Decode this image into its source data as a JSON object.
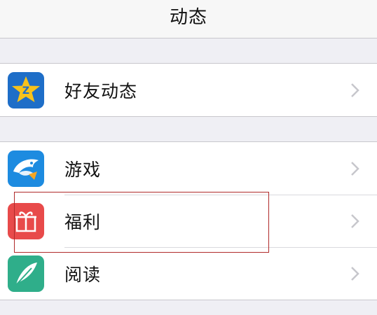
{
  "navbar": {
    "title": "动态"
  },
  "groups": [
    {
      "items": [
        {
          "label": "好友动态",
          "icon": "qzone-star-icon"
        }
      ]
    },
    {
      "items": [
        {
          "label": "游戏",
          "icon": "game-shark-icon"
        },
        {
          "label": "福利",
          "icon": "gift-icon"
        },
        {
          "label": "阅读",
          "icon": "reading-feather-icon"
        }
      ]
    }
  ],
  "colors": {
    "qzone_icon_bg": "#1e6ec8",
    "qzone_star": "#f7c21b",
    "game_icon_bg": "#1d8be0",
    "gift_icon_bg": "#e84a4a",
    "reading_icon_bg": "#2fae8a",
    "highlight_border": "#b02a2a"
  }
}
